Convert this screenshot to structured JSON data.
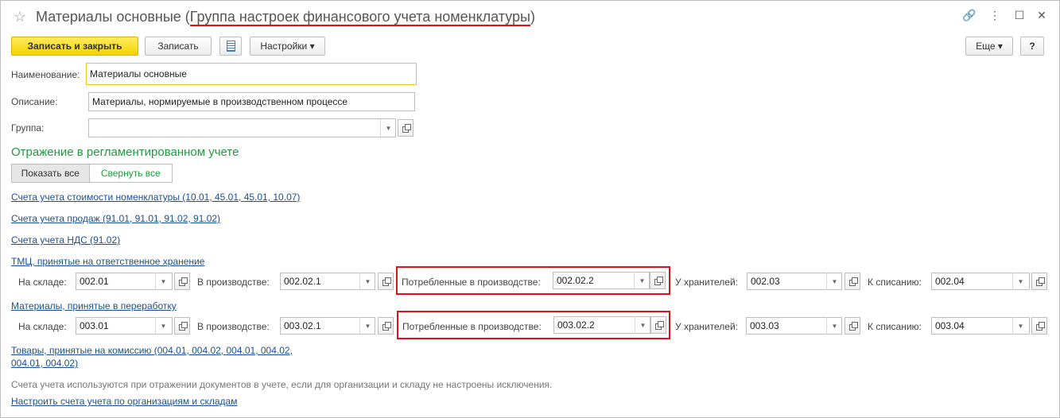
{
  "window": {
    "title_prefix": "Материалы основные (",
    "title_group": "Группа настроек финансового учета номенклатуры",
    "title_suffix": ")",
    "star_icon": "☆",
    "link_icon": "🔗",
    "more_icon": "⋮",
    "maximize_icon": "☐",
    "close_icon": "✕"
  },
  "toolbar": {
    "save_close_label": "Записать и закрыть",
    "save_label": "Записать",
    "settings_label": "Настройки ▾",
    "more_label": "Еще ▾",
    "help_label": "?"
  },
  "form": {
    "name_label": "Наименование:",
    "name_value": "Материалы основные",
    "desc_label": "Описание:",
    "desc_value": "Материалы, нормируемые в производственном процессе",
    "group_label": "Группа:",
    "group_value": ""
  },
  "section": {
    "title": "Отражение в регламентированном учете",
    "show_all": "Показать все",
    "collapse_all": "Свернуть все"
  },
  "links": {
    "cost_accounts": "Счета учета стоимости номенклатуры (10.01, 45.01, 45.01, 10.07)",
    "sales_accounts": "Счета учета продаж (91.01, 91.01, 91.02, 91.02)",
    "vat_accounts": "Счета учета НДС (91.02)",
    "safekeeping": "ТМЦ, принятые на ответственное хранение",
    "processing": "Материалы, принятые в переработку",
    "commission_line1": "Товары, принятые на комиссию (004.01, 004.02, 004.01, 004.02,",
    "commission_line2": "004.01, 004.02)",
    "configure": "Настроить счета учета по организациям и складам"
  },
  "rows": [
    {
      "warehouse_label": "На складе:",
      "warehouse_value": "002.01",
      "production_label": "В производстве:",
      "production_value": "002.02.1",
      "consumed_label": "Потребленные в производстве:",
      "consumed_value": "002.02.2",
      "keepers_label": "У хранителей:",
      "keepers_value": "002.03",
      "writeoff_label": "К списанию:",
      "writeoff_value": "002.04"
    },
    {
      "warehouse_label": "На складе:",
      "warehouse_value": "003.01",
      "production_label": "В производстве:",
      "production_value": "003.02.1",
      "consumed_label": "Потребленные в производстве:",
      "consumed_value": "003.02.2",
      "keepers_label": "У хранителей:",
      "keepers_value": "003.03",
      "writeoff_label": "К списанию:",
      "writeoff_value": "003.04"
    }
  ],
  "footer": {
    "note": "Счета учета используются при отражении документов в учете, если для организации и складу не настроены исключения."
  },
  "colors": {
    "accent_yellow": "#f5d200",
    "section_green": "#1f9b3c",
    "link_blue": "#1a4f9c",
    "highlight_red": "#d8151a"
  }
}
